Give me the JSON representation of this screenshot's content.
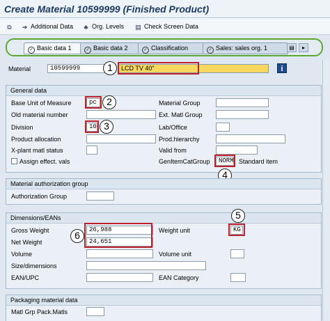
{
  "title": "Create Material 10599999 (Finished Product)",
  "toolbar": {
    "additional_data": "Additional Data",
    "org_levels": "Org. Levels",
    "check_screen_data": "Check Screen Data"
  },
  "tabs": [
    "Basic data 1",
    "Basic data 2",
    "Classification",
    "Sales: sales org. 1"
  ],
  "material": {
    "label": "Material",
    "number": "10599999",
    "description": "LCD TV 40\""
  },
  "general": {
    "header": "General data",
    "base_uom_label": "Base Unit of Measure",
    "base_uom_value": "pc",
    "old_material_label": "Old material number",
    "division_label": "Division",
    "division_value": "10",
    "product_allocation_label": "Product allocation",
    "xplant_status_label": "X-plant matl status",
    "assign_effect_label": "Assign effect. vals",
    "material_group_label": "Material Group",
    "ext_matl_group_label": "Ext. Matl Group",
    "lab_office_label": "Lab/Office",
    "prod_hierarchy_label": "Prod.hierarchy",
    "valid_from_label": "Valid from",
    "gen_item_cat_label": "GenItemCatGroup",
    "gen_item_cat_value": "NORM",
    "gen_item_cat_desc": "Standard item"
  },
  "auth": {
    "header": "Material authorization group",
    "group_label": "Authorization Group"
  },
  "dims": {
    "header": "Dimensions/EANs",
    "gross_weight_label": "Gross Weight",
    "gross_weight_value": "26,988",
    "net_weight_label": "Net Weight",
    "net_weight_value": "24,651",
    "volume_label": "Volume",
    "size_label": "Size/dimensions",
    "ean_label": "EAN/UPC",
    "weight_unit_label": "Weight unit",
    "weight_unit_value": "KG",
    "volume_unit_label": "Volume unit",
    "ean_category_label": "EAN Category"
  },
  "packaging": {
    "header": "Packaging material data",
    "matl_grp_label": "Matl Grp Pack.Matls"
  },
  "callouts": [
    "1",
    "2",
    "3",
    "4",
    "5",
    "6"
  ],
  "colors": {
    "highlight_field": "#f7d75e",
    "callout_border": "#c0202a",
    "tab_outline": "#5aa832"
  }
}
